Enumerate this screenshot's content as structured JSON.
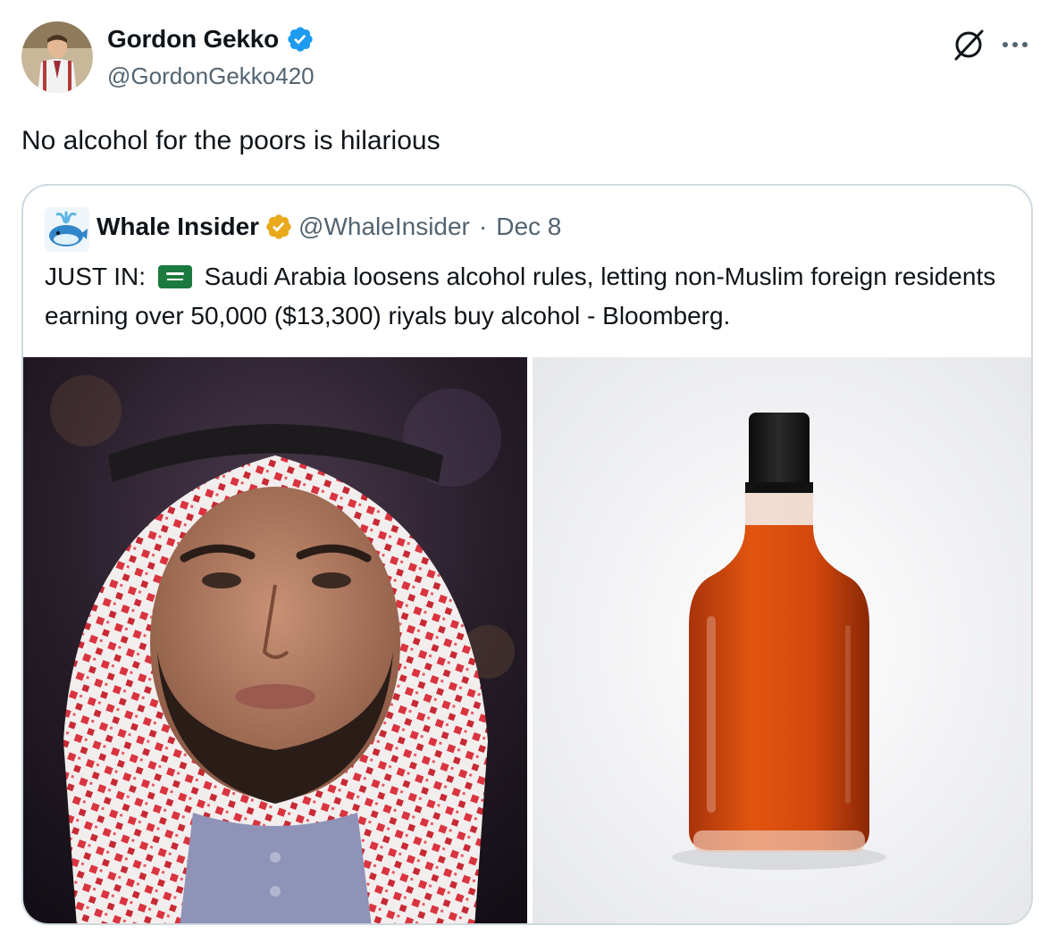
{
  "tweet": {
    "author": {
      "name": "Gordon Gekko",
      "handle": "@GordonGekko420"
    },
    "text": "No alcohol for the poors is hilarious",
    "actions": {
      "grok_icon": "grok-icon",
      "more_icon": "more-icon"
    }
  },
  "quoted_tweet": {
    "author": {
      "name": "Whale Insider",
      "handle": "@WhaleInsider"
    },
    "separator": "·",
    "date": "Dec 8",
    "text_prefix": "JUST IN:",
    "flag_icon": "saudi-flag-icon",
    "text_body": "Saudi Arabia loosens alcohol rules, letting non-Muslim foreign residents earning over 50,000 ($13,300) riyals buy alcohol - Bloomberg.",
    "media": [
      {
        "subject": "man-in-red-keffiyeh-photo"
      },
      {
        "subject": "amber-liquor-bottle-photo"
      }
    ]
  },
  "colors": {
    "verified_blue": "#1d9bf0",
    "verified_gold": "#e8a91b",
    "secondary_text": "#536471",
    "border": "#cfd9de"
  }
}
